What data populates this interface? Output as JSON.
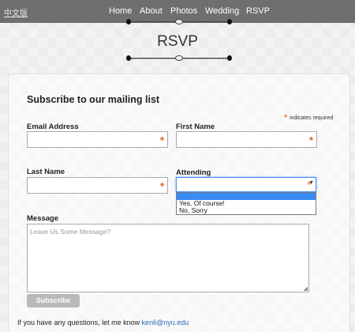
{
  "header": {
    "lang_link": "中文版",
    "nav": [
      "Home",
      "About",
      "Photos",
      "Wedding",
      "RSVP"
    ]
  },
  "page": {
    "title": "RSVP"
  },
  "form": {
    "title": "Subscribe to our mailing list",
    "required_star": "*",
    "required_note": "indicates required",
    "fields": {
      "email_label": "Email Address",
      "first_name_label": "First Name",
      "last_name_label": "Last Name",
      "attending_label": "Attending",
      "message_label": "Message",
      "message_placeholder": "Leave Us Some Message?"
    },
    "attending_options": [
      "",
      "Yes, Of course!",
      "No, Sorry"
    ],
    "submit_label": "Subscribe"
  },
  "footer": {
    "text": "If you have any questions, let me know",
    "email": "kenli@nyu.edu"
  },
  "colors": {
    "nav_bg": "#6f6f6f",
    "required_star": "#d8621a",
    "select_highlight": "#3b8bf5",
    "link": "#2a6ebf"
  }
}
